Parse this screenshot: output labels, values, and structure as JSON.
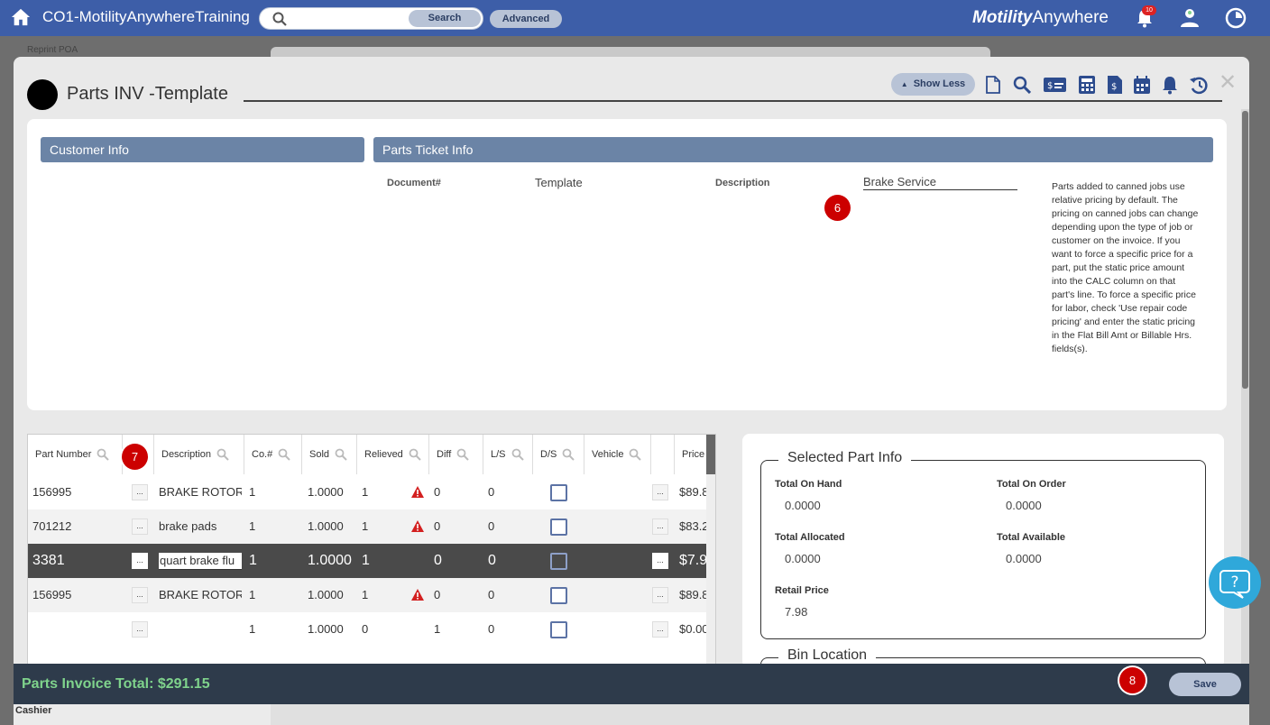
{
  "topbar": {
    "app_title": "CO1-MotilityAnywhereTraining",
    "search_placeholder": "",
    "search_label": "Search",
    "advanced_label": "Advanced",
    "brand_bold": "Motility",
    "brand_light": "Anywhere",
    "notification_count": "10"
  },
  "background": {
    "reprint_label": "Reprint POA",
    "cashier_label": "Cashier"
  },
  "modal": {
    "title": "Parts INV -Template",
    "show_less_label": "Show Less",
    "toolbar_icons": [
      "document-icon",
      "search-icon",
      "payment-card-icon",
      "calculator-icon",
      "invoice-dollar-icon",
      "calendar-icon",
      "bell-icon",
      "history-icon"
    ],
    "close_label": "✕"
  },
  "customer_info": {
    "header": "Customer Info"
  },
  "ticket_info": {
    "header": "Parts Ticket Info",
    "document_label": "Document#",
    "document_value": "Template",
    "description_label": "Description",
    "description_value": "Brake Service",
    "note": "Parts added to canned jobs use relative pricing by default. The pricing on canned jobs can change depending upon the type of job or customer on the invoice. If you want to force a specific price for a part, put the static price amount into the CALC column on that part's line. To force a specific price for labor, check 'Use repair code pricing' and enter the static pricing in the Flat Bill Amt or Billable Hrs. fields(s)."
  },
  "markers": {
    "m6": "6",
    "m7": "7",
    "m8": "8"
  },
  "grid": {
    "headers": [
      "Part Number",
      "Description",
      "Co.#",
      "Sold",
      "Relieved",
      "Diff",
      "L/S",
      "D/S",
      "Vehicle",
      "Price"
    ],
    "rows": [
      {
        "part": "156995",
        "dots": "...",
        "desc": "BRAKE ROTOR",
        "co": "1",
        "sold": "1.0000",
        "relieved": "1",
        "diff": "0",
        "ls": "0",
        "vdots": "...",
        "price": "$89.8"
      },
      {
        "part": "701212",
        "dots": "...",
        "desc": "brake pads",
        "co": "1",
        "sold": "1.0000",
        "relieved": "1",
        "diff": "0",
        "ls": "0",
        "vdots": "...",
        "price": "$83.2"
      },
      {
        "part": "3381",
        "dots": "...",
        "desc": "quart brake flu",
        "co": "1",
        "sold": "1.0000",
        "relieved": "1",
        "diff": "0",
        "ls": "0",
        "vdots": "...",
        "price": "$7.9"
      },
      {
        "part": "156995",
        "dots": "...",
        "desc": "BRAKE ROTOR",
        "co": "1",
        "sold": "1.0000",
        "relieved": "1",
        "diff": "0",
        "ls": "0",
        "vdots": "...",
        "price": "$89.8"
      },
      {
        "part": "",
        "dots": "...",
        "desc": "",
        "co": "1",
        "sold": "1.0000",
        "relieved": "0",
        "diff": "1",
        "ls": "0",
        "vdots": "...",
        "price": "$0.00"
      }
    ]
  },
  "part_info": {
    "legend": "Selected Part Info",
    "on_hand_label": "Total On Hand",
    "on_hand_value": "0.0000",
    "on_order_label": "Total On Order",
    "on_order_value": "0.0000",
    "allocated_label": "Total Allocated",
    "allocated_value": "0.0000",
    "available_label": "Total Available",
    "available_value": "0.0000",
    "retail_label": "Retail Price",
    "retail_value": "7.98",
    "bin_legend": "Bin Location"
  },
  "footer": {
    "total": "Parts Invoice Total: $291.15",
    "save_label": "Save"
  },
  "colors": {
    "topbar": "#3d5ea8",
    "section_header": "#6b84a6",
    "footer": "#2e3b4b",
    "total_text": "#7fd38c",
    "marker": "#cc0000",
    "help": "#2fa8da"
  }
}
